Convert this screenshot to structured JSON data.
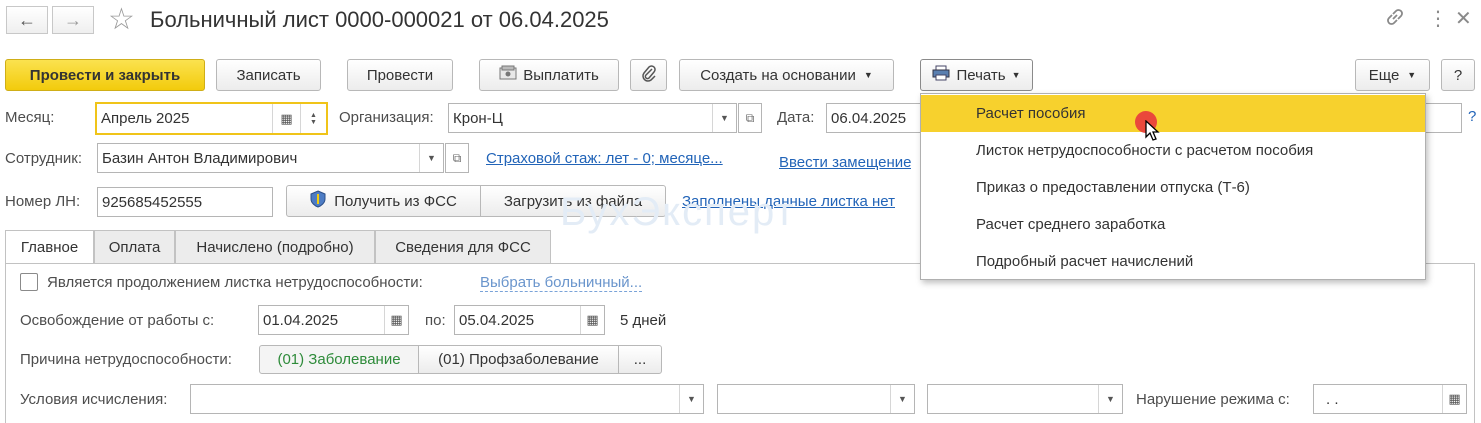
{
  "title": "Больничный лист 0000-000021 от 06.04.2025",
  "nav": {
    "back": "←",
    "forward": "→",
    "star": "☆",
    "link": "🔗",
    "more": "⋮",
    "close": "✕"
  },
  "toolbar": {
    "post_close": "Провести и закрыть",
    "save": "Записать",
    "post": "Провести",
    "pay": "Выплатить",
    "create_based": "Создать на основании",
    "print": "Печать",
    "more": "Еще",
    "help": "?"
  },
  "fields": {
    "month_label": "Месяц:",
    "month_value": "Апрель 2025",
    "org_label": "Организация:",
    "org_value": "Крон-Ц",
    "date_label": "Дата:",
    "date_value": "06.04.2025",
    "employee_label": "Сотрудник:",
    "employee_value": "Базин Антон Владимирович",
    "insurance_link": "Страховой стаж: лет - 0; месяце...",
    "replacement_link": "Ввести замещение",
    "ln_label": "Номер ЛН:",
    "ln_value": "925685452555",
    "fss_get": "Получить из ФСС",
    "load_file": "Загрузить из файла",
    "filled_link": "Заполнены данные листка нет",
    "help_q": "?"
  },
  "tabs": [
    "Главное",
    "Оплата",
    "Начислено (подробно)",
    "Сведения для ФСС"
  ],
  "main": {
    "continuation_label": "Является продолжением листка нетрудоспособности:",
    "choose_link": "Выбрать больничный...",
    "release_label": "Освобождение от работы с:",
    "release_from": "01.04.2025",
    "release_to_label": "по:",
    "release_to": "05.04.2025",
    "days": "5 дней",
    "cause_label": "Причина нетрудоспособности:",
    "cause_1": "(01) Заболевание",
    "cause_2": "(01) Профзаболевание",
    "cause_more": "...",
    "conditions_label": "Условия исчисления:",
    "violation_label": "Нарушение режима с:",
    "violation_value": ". ."
  },
  "print_menu": [
    "Расчет пособия",
    "Листок нетрудоспособности с расчетом пособия",
    "Приказ о предоставлении отпуска (Т-6)",
    "Расчет среднего заработка",
    "Подробный расчет начислений"
  ],
  "watermark": "БухЭксперт",
  "colors": {
    "accent": "#f2cb0c",
    "highlight": "#f7d12d",
    "link": "#2264b8",
    "cause_active": "#2e8b3a",
    "cursor_dot": "#e8383d"
  }
}
